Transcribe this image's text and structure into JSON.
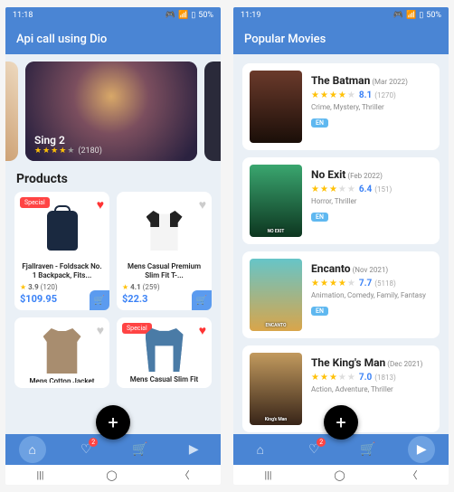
{
  "status": {
    "time1": "11:18",
    "time2": "11:19",
    "battery": "50%"
  },
  "left": {
    "title": "Api call using Dio",
    "carousel": {
      "title": "Sing 2",
      "count": "(2180)"
    },
    "section": "Products",
    "special": "Special",
    "p1": {
      "name": "Fjallraven - Foldsack No. 1 Backpack, Fits...",
      "rating": "3.9",
      "rcount": "(120)",
      "price": "$109.95",
      "fav": true,
      "special": true
    },
    "p2": {
      "name": "Mens Casual Premium Slim Fit T-...",
      "rating": "4.1",
      "rcount": "(259)",
      "price": "$22.3",
      "fav": false,
      "special": false
    },
    "p3": {
      "name": "Mens Cotton Jacket",
      "special": false,
      "fav": false
    },
    "p4": {
      "name": "Mens Casual Slim Fit",
      "special": true,
      "fav": true
    }
  },
  "right": {
    "title": "Popular Movies",
    "lang": "EN",
    "m1": {
      "title": "The Batman",
      "date": "(Mar 2022)",
      "score": "8.1",
      "votes": "(1270)",
      "genres": "Crime, Mystery, Thriller"
    },
    "m2": {
      "title": "No Exit",
      "date": "(Feb 2022)",
      "score": "6.4",
      "votes": "(151)",
      "genres": "Horror, Thriller",
      "poster_label": "NO EXIT"
    },
    "m3": {
      "title": "Encanto",
      "date": "(Nov 2021)",
      "score": "7.7",
      "votes": "(5118)",
      "genres": "Animation, Comedy, Family, Fantasy",
      "poster_label": "ENCANTO"
    },
    "m4": {
      "title": "The King's Man",
      "date": "(Dec 2021)",
      "score": "7.0",
      "votes": "(1813)",
      "genres": "Action, Adventure, Thriller",
      "poster_label": "King's Man"
    }
  },
  "nav": {
    "fav_badge": "2"
  }
}
